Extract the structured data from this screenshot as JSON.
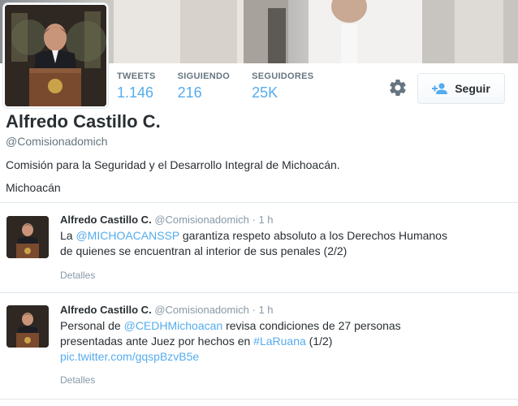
{
  "profile": {
    "name": "Alfredo Castillo C.",
    "handle": "@Comisionadomich",
    "bio": "Comisión para la Seguridad y el Desarrollo Integral de Michoacán.",
    "location": "Michoacán"
  },
  "stats": [
    {
      "label": "TWEETS",
      "value": "1.146"
    },
    {
      "label": "SIGUIENDO",
      "value": "216"
    },
    {
      "label": "SEGUIDORES",
      "value": "25K"
    }
  ],
  "actions": {
    "follow_label": "Seguir",
    "settings_icon": "gear-icon",
    "follow_icon": "add-user-icon"
  },
  "tweets": [
    {
      "name": "Alfredo Castillo C.",
      "handle": "@Comisionadomich",
      "time": "1 h",
      "line1_pre": "La ",
      "line1_mention": "@MICHOACANSSP",
      "line1_post": " garantiza respeto absoluto a los Derechos Humanos",
      "line2": "de quienes se encuentran al interior de sus penales (2/2)",
      "details_label": "Detalles"
    },
    {
      "name": "Alfredo Castillo C.",
      "handle": "@Comisionadomich",
      "time": "1 h",
      "line1_pre": "Personal de ",
      "line1_mention": "@CEDHMichoacan",
      "line1_post": " revisa condiciones de 27 personas",
      "line2_pre": "presentadas ante Juez por hechos en ",
      "line2_hashtag": "#LaRuana",
      "line2_post": " (1/2)",
      "line3_link": "pic.twitter.com/gqspBzvB5e",
      "details_label": "Detalles"
    }
  ],
  "colors": {
    "accent": "#55acee",
    "text": "#292f33",
    "muted": "#8899a6",
    "border": "#e1e8ed"
  }
}
